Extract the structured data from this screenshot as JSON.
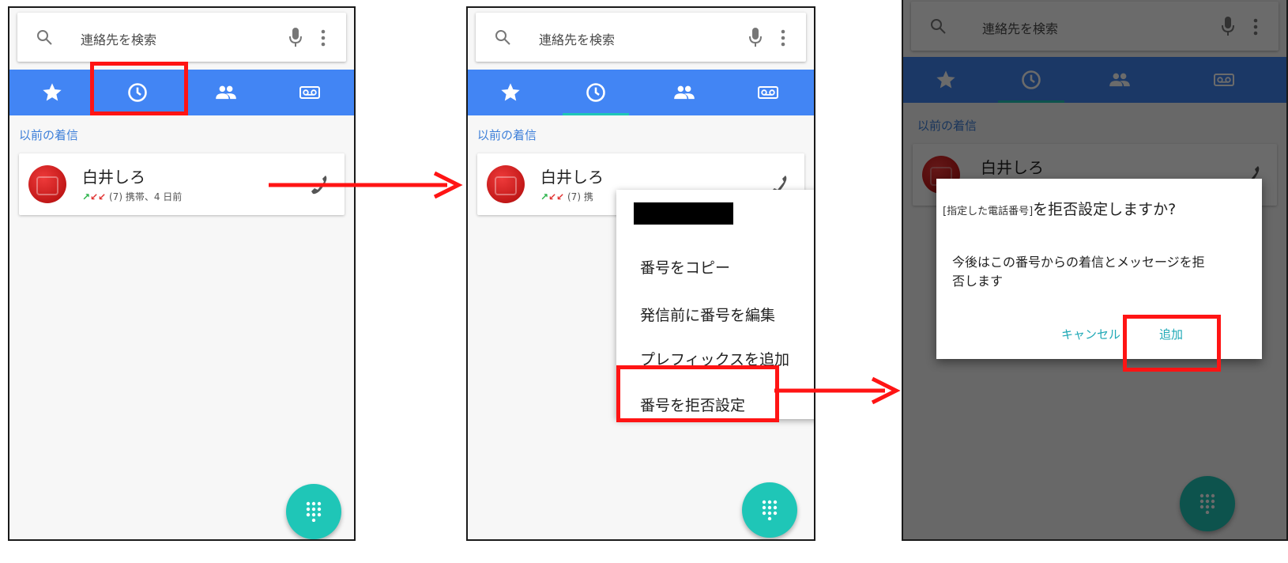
{
  "search": {
    "placeholder": "連絡先を検索"
  },
  "tabs": [
    "star-icon",
    "clock-icon",
    "people-icon",
    "voicemail-icon"
  ],
  "call_log": {
    "section_label": "以前の着信",
    "entry": {
      "name": "白井しろ",
      "count": "(7)",
      "detail": "携帯、4 日前",
      "detail_short": "携"
    }
  },
  "context_menu": {
    "items": [
      "番号をコピー",
      "発信前に番号を編集",
      "プレフィックスを追加",
      "番号を拒否設定"
    ]
  },
  "dialog": {
    "title_placeholder": "[指定した電話番号]",
    "title_suffix": "を拒否設定しますか?",
    "message": "今後はこの番号からの着信とメッセージを拒否します",
    "cancel": "キャンセル",
    "add": "追加"
  },
  "colors": {
    "tab_bar": "#4285f4",
    "accent": "#1fc6b7",
    "highlight": "#ff1414",
    "avatar": "#d32222"
  }
}
